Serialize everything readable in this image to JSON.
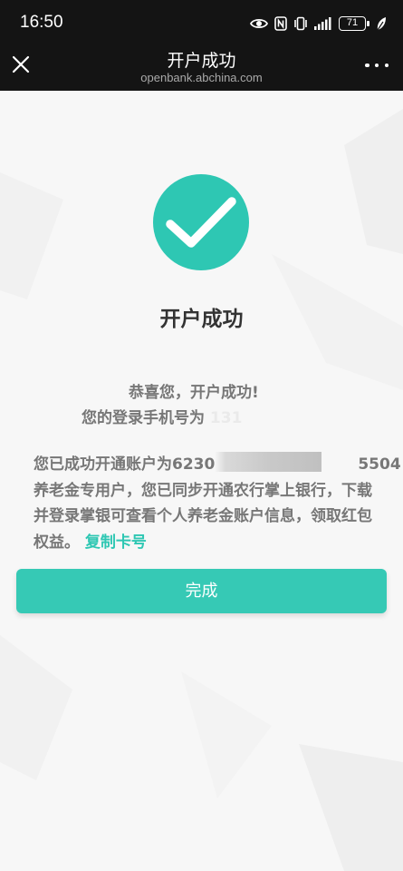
{
  "status_bar": {
    "time": "16:50",
    "battery": "71",
    "icons": [
      "eye-icon",
      "nfc-icon",
      "vibrate-icon",
      "signal-icon",
      "battery-icon",
      "leaf-icon"
    ]
  },
  "nav": {
    "title": "开户成功",
    "url": "openbank.abchina.com",
    "close_icon": "close-icon",
    "more_icon": "more-icon"
  },
  "main": {
    "title": "开户成功",
    "congrats": "恭喜您，开户成功!",
    "phone_label": "您的登录手机号为",
    "phone_masked": "131",
    "account_prefix": "您已成功开通账户为6230",
    "account_suffix": "5504",
    "account_body": "养老金专用户，您已同步开通农行掌上银行，下载并登录掌银可查看个人养老金账户信息，领取红包权益。",
    "copy_link": "复制卡号",
    "done_button": "完成"
  },
  "colors": {
    "accent": "#2ec7b3",
    "button": "#36c9b5",
    "topbar": "#141414"
  }
}
